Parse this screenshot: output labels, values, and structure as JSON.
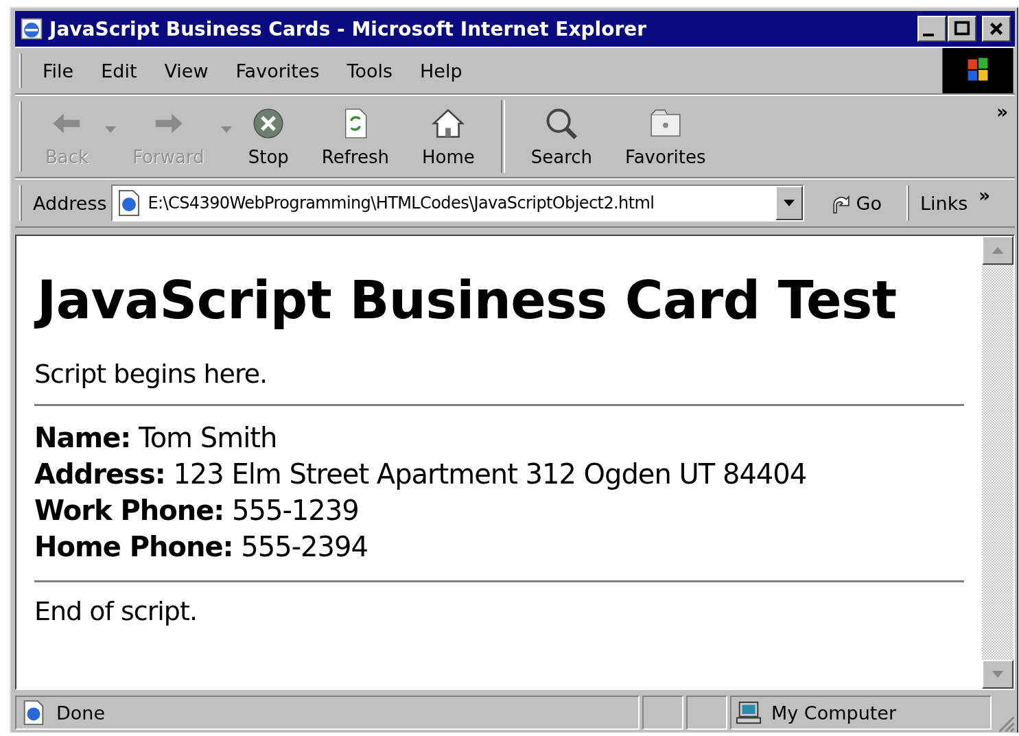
{
  "window": {
    "title": "JavaScript Business Cards - Microsoft Internet Explorer"
  },
  "menu": [
    {
      "label": "File"
    },
    {
      "label": "Edit"
    },
    {
      "label": "View"
    },
    {
      "label": "Favorites"
    },
    {
      "label": "Tools"
    },
    {
      "label": "Help"
    }
  ],
  "toolbar": {
    "groups": [
      [
        {
          "kind": "back",
          "label": "Back",
          "disabled": true,
          "dropdown": true
        },
        {
          "kind": "forward",
          "label": "Forward",
          "disabled": true,
          "dropdown": true
        },
        {
          "kind": "stop",
          "label": "Stop",
          "disabled": false,
          "dropdown": false
        },
        {
          "kind": "refresh",
          "label": "Refresh",
          "disabled": false,
          "dropdown": false
        },
        {
          "kind": "home",
          "label": "Home",
          "disabled": false,
          "dropdown": false
        }
      ],
      [
        {
          "kind": "search",
          "label": "Search",
          "disabled": false,
          "dropdown": false
        },
        {
          "kind": "favorites",
          "label": "Favorites",
          "disabled": false,
          "dropdown": false
        }
      ]
    ],
    "more": "»"
  },
  "address_bar": {
    "label": "Address",
    "value": "E:\\CS4390WebProgramming\\HTMLCodes\\JavaScriptObject2.html",
    "go": "Go",
    "links": "Links",
    "more": "»"
  },
  "page": {
    "heading": "JavaScript Business Card Test",
    "intro": "Script begins here.",
    "fields": [
      "**Name:** Tom Smith",
      "**Address:** 123 Elm Street Apartment 312 Ogden UT 84404",
      "**Work Phone:** 555-1239",
      "**Home Phone:** 555-2394"
    ],
    "outro": "End of script."
  },
  "status_bar": {
    "status": "Done",
    "zone": "My Computer"
  }
}
